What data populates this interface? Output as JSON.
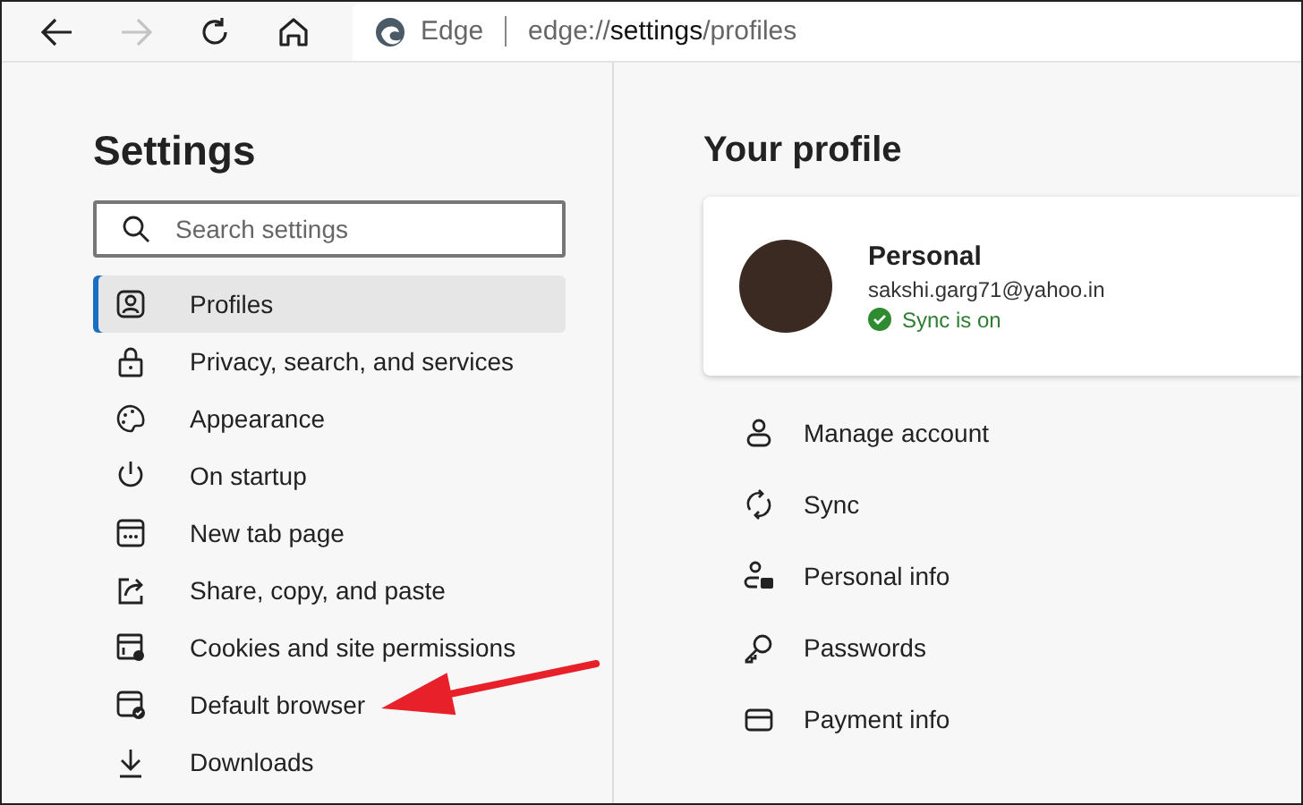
{
  "toolbar": {
    "brand": "Edge",
    "url": {
      "prefix": "edge://",
      "strong": "settings",
      "suffix": "/profiles"
    },
    "forward_disabled": true
  },
  "sidebar": {
    "title": "Settings",
    "search": {
      "placeholder": "Search settings"
    },
    "items": [
      {
        "label": "Profiles",
        "selected": true,
        "arrow": false
      },
      {
        "label": "Privacy, search, and services",
        "selected": false,
        "arrow": false
      },
      {
        "label": "Appearance",
        "selected": false,
        "arrow": false
      },
      {
        "label": "On startup",
        "selected": false,
        "arrow": false
      },
      {
        "label": "New tab page",
        "selected": false,
        "arrow": false
      },
      {
        "label": "Share, copy, and paste",
        "selected": false,
        "arrow": false
      },
      {
        "label": "Cookies and site permissions",
        "selected": false,
        "arrow": false
      },
      {
        "label": "Default browser",
        "selected": false,
        "arrow": true
      },
      {
        "label": "Downloads",
        "selected": false,
        "arrow": false
      }
    ]
  },
  "main": {
    "title": "Your profile",
    "profile": {
      "name": "Personal",
      "email": "sakshi.garg71@yahoo.in",
      "sync": "Sync is on",
      "sync_on": true
    },
    "items": [
      {
        "label": "Manage account"
      },
      {
        "label": "Sync"
      },
      {
        "label": "Personal info"
      },
      {
        "label": "Passwords"
      },
      {
        "label": "Payment info"
      }
    ]
  }
}
